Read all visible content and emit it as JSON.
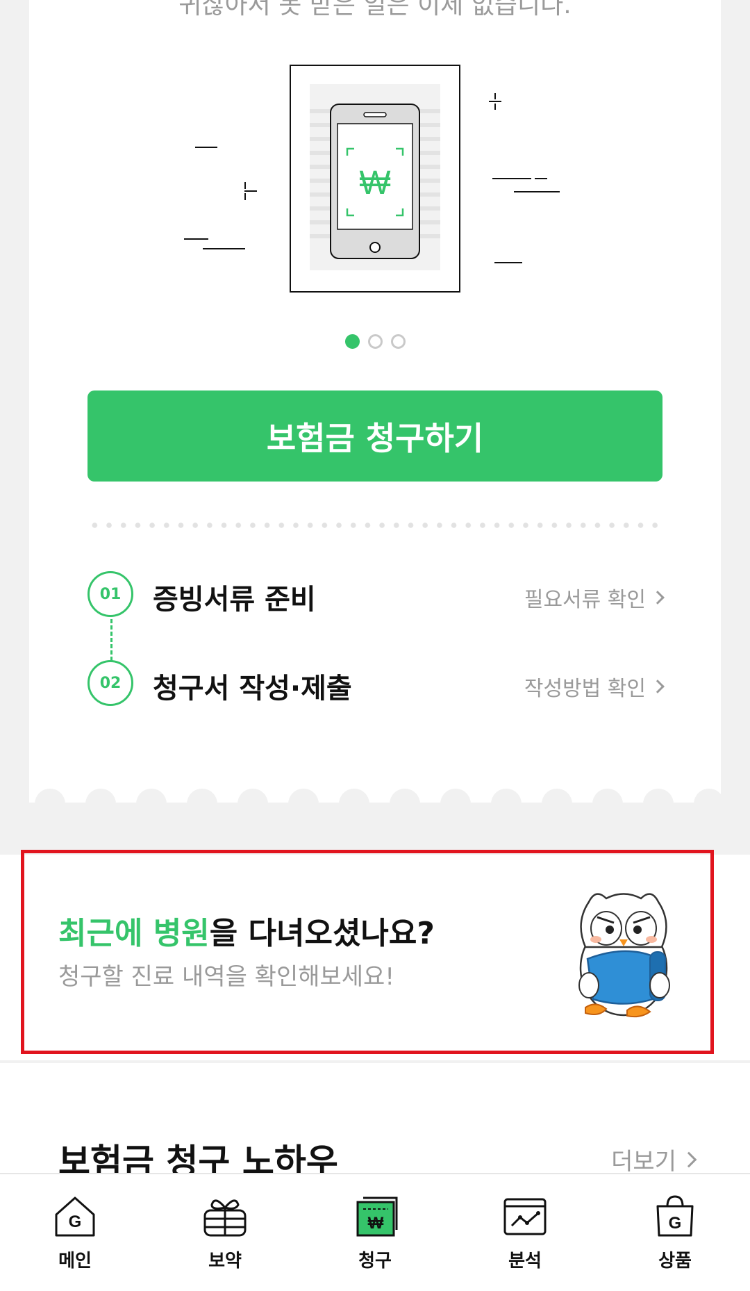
{
  "top_subtitle": "귀찮아서 못 받은 일은 이제 없습니다.",
  "carousel": {
    "count": 3,
    "active": 0
  },
  "claim_button": "보험금 청구하기",
  "steps": [
    {
      "number": "01",
      "title": "증빙서류 준비",
      "link": "필요서류 확인"
    },
    {
      "number": "02",
      "title": "청구서 작성·제출",
      "link": "작성방법 확인"
    }
  ],
  "promo": {
    "title_highlight": "최근에 병원",
    "title_rest": "을 다녀오셨나요?",
    "subtitle": "청구할 진료 내역을 확인해보세요!"
  },
  "knowhow": {
    "title": "보험금 청구 노하우",
    "more": "더보기"
  },
  "bottom_nav": [
    {
      "label": "메인",
      "icon": "home-g-icon"
    },
    {
      "label": "보약",
      "icon": "gift-icon"
    },
    {
      "label": "청구",
      "icon": "claim-won-icon",
      "active": true
    },
    {
      "label": "분석",
      "icon": "analysis-chart-icon"
    },
    {
      "label": "상품",
      "icon": "shopping-bag-g-icon"
    }
  ],
  "colors": {
    "accent": "#35c46a",
    "highlight_border": "#e1141e",
    "muted_text": "#9a9a9a"
  }
}
